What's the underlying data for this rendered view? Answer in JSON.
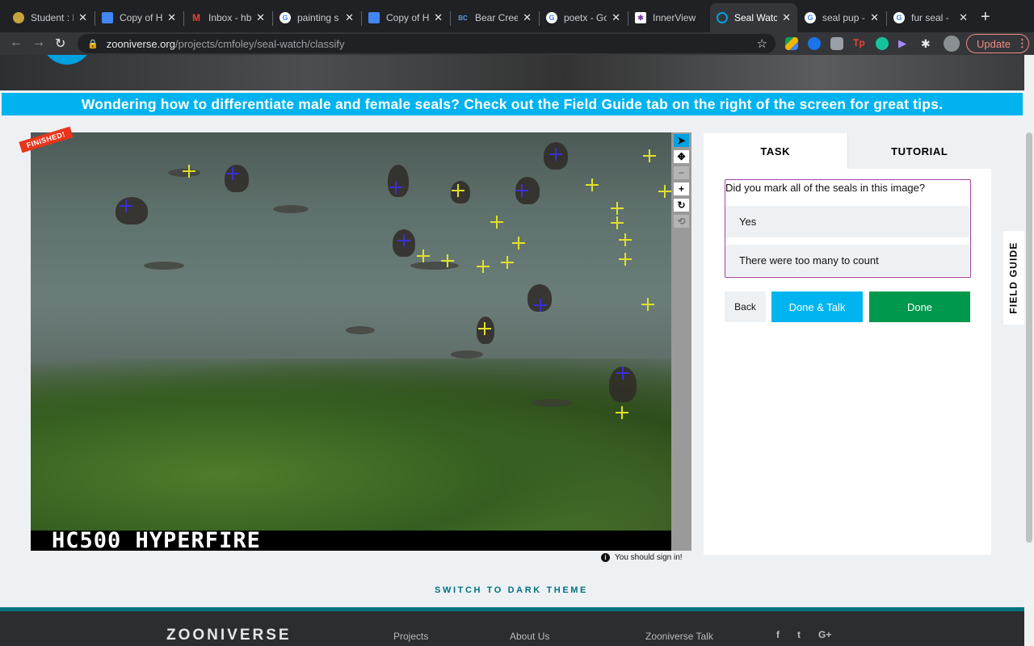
{
  "browser": {
    "tabs": [
      {
        "title": "Student : I",
        "icon": "student-icon",
        "color": "#c8a23a",
        "active": false
      },
      {
        "title": "Copy of H",
        "icon": "docs-icon",
        "color": "#4285f4",
        "active": false
      },
      {
        "title": "Inbox - hb",
        "icon": "gmail-icon",
        "color": "#ea4335",
        "active": false
      },
      {
        "title": "painting s",
        "icon": "google-icon",
        "color": "#ffffff",
        "active": false
      },
      {
        "title": "Copy of H",
        "icon": "docs-icon",
        "color": "#4285f4",
        "active": false
      },
      {
        "title": "Bear Cree",
        "icon": "bearcreek-icon",
        "color": "#2a6fb5",
        "active": false
      },
      {
        "title": "poetx - Go",
        "icon": "google-icon",
        "color": "#ffffff",
        "active": false
      },
      {
        "title": "InnerView",
        "icon": "innerview-icon",
        "color": "#7b3fa0",
        "active": false
      },
      {
        "title": "Seal Watc",
        "icon": "zooniverse-icon",
        "color": "#00a1e1",
        "active": true
      },
      {
        "title": "seal pup -",
        "icon": "google-icon",
        "color": "#ffffff",
        "active": false
      },
      {
        "title": "fur seal -",
        "icon": "google-icon",
        "color": "#ffffff",
        "active": false
      }
    ],
    "url_host": "zooniverse.org",
    "url_path": "/projects/cmfoley/seal-watch/classify",
    "update_label": "Update"
  },
  "banner": {
    "text": "Wondering how to differentiate male and female seals? Check out the Field Guide tab on the right of the screen for great tips."
  },
  "subject": {
    "finished_label": "FINISHED!",
    "camera_label": "HC500 HYPERFIRE",
    "signin_text": "You should sign in!"
  },
  "task": {
    "tabs": [
      {
        "label": "TASK",
        "active": true
      },
      {
        "label": "TUTORIAL",
        "active": false
      }
    ],
    "question": "Did you mark all of the seals in this image?",
    "answers": [
      "Yes",
      "There were too many to count"
    ],
    "back_label": "Back",
    "done_talk_label": "Done & Talk",
    "done_label": "Done"
  },
  "field_guide_label": "FIELD GUIDE",
  "dark_theme_label": "SWITCH TO DARK THEME",
  "footer": {
    "logo": "ZOONIVERSE",
    "links": [
      "Projects",
      "About Us",
      "Zooniverse Talk"
    ],
    "social": [
      "f",
      "t",
      "G+"
    ]
  },
  "colors": {
    "accent": "#00b3ee",
    "done_green": "#00984c",
    "question_border": "#a043a0",
    "marker_yellow": "#e2e12a",
    "marker_blue": "#3a2ed6"
  }
}
